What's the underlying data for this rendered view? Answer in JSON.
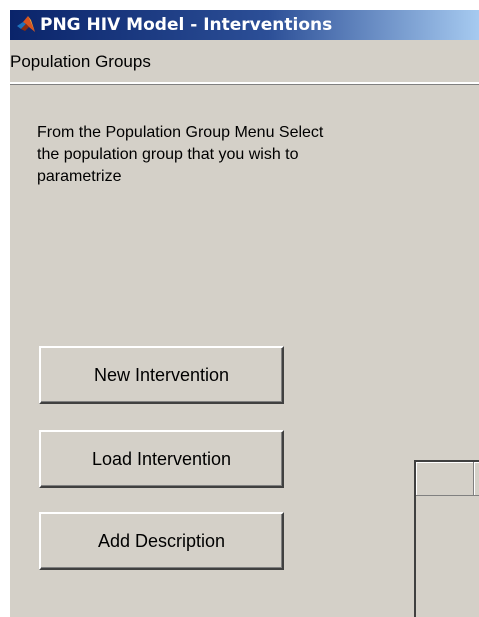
{
  "window": {
    "title": "PNG HIV Model - Interventions",
    "icon": "matlab-icon"
  },
  "menubar": {
    "items": [
      {
        "label": "Population Groups"
      }
    ]
  },
  "main": {
    "instructions": "From the Population Group Menu Select the population group that you wish to parametrize",
    "buttons": {
      "new_intervention": "New Intervention",
      "load_intervention": "Load Intervention",
      "add_description": "Add Description"
    }
  },
  "colors": {
    "window_bg": "#d4d0c8",
    "titlebar_start": "#0a246a",
    "titlebar_end": "#a6caf0",
    "title_text": "#ffffff"
  }
}
